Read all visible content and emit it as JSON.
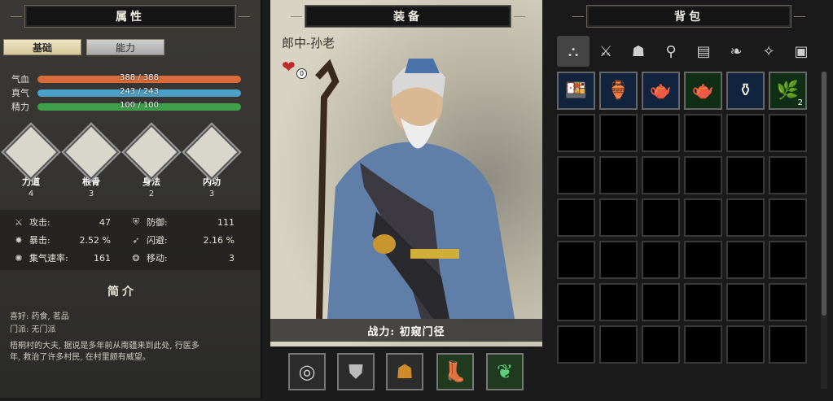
{
  "left": {
    "header": "属性",
    "tabs": [
      "基础",
      "能力"
    ],
    "bars": [
      {
        "label": "气血",
        "value": "388 / 388",
        "fill": 1.0,
        "color": "#d96a3a"
      },
      {
        "label": "真气",
        "value": "243 / 243",
        "fill": 1.0,
        "color": "#4aa0c8"
      },
      {
        "label": "精力",
        "value": "100 / 100",
        "fill": 1.0,
        "color": "#3fa04a"
      }
    ],
    "attributes": [
      {
        "name": "力道",
        "value": "4",
        "icon": "strength-figure-icon"
      },
      {
        "name": "根骨",
        "value": "3",
        "icon": "constitution-figure-icon"
      },
      {
        "name": "身法",
        "value": "2",
        "icon": "agility-figure-icon"
      },
      {
        "name": "内功",
        "value": "3",
        "icon": "inner-force-figure-icon"
      }
    ],
    "combat": [
      {
        "icon": "sword-icon",
        "label": "攻击:",
        "value": "47"
      },
      {
        "icon": "shield-icon",
        "label": "防御:",
        "value": "111"
      },
      {
        "icon": "burst-icon",
        "label": "暴击:",
        "value": "2.52 %"
      },
      {
        "icon": "dodge-icon",
        "label": "闪避:",
        "value": "2.16 %"
      },
      {
        "icon": "gather-icon",
        "label": "集气速率:",
        "value": "161"
      },
      {
        "icon": "footprint-icon",
        "label": "移动:",
        "value": "3"
      }
    ],
    "intro_title": "简介",
    "intro_lines": [
      "喜好: 药食, 茗品",
      "门派: 无门派",
      "梧桐村的大夫, 据说是多年前从南疆来到此处, 行医多",
      "年, 救治了许多村民, 在村里颇有威望。"
    ]
  },
  "middle": {
    "header": "装备",
    "character_name": "郎中-孙老",
    "heart_count": "0",
    "power_text": "战力: 初窥门径",
    "equipment": [
      "ring-icon",
      "armor-icon",
      "helmet-icon",
      "boots-icon",
      "jade-pendant-icon"
    ]
  },
  "right": {
    "header": "背包",
    "tabs": [
      "all-icon",
      "weapon-icon",
      "armor-icon",
      "accessory-icon",
      "book-icon",
      "herb-icon",
      "skill-icon",
      "misc-icon"
    ],
    "items": [
      {
        "icon": "tray-icon",
        "glyph": "🍱",
        "count": ""
      },
      {
        "icon": "bottle-icon",
        "glyph": "🏺",
        "count": ""
      },
      {
        "icon": "teapot-icon",
        "glyph": "🫖",
        "count": ""
      },
      {
        "icon": "dark-teapot-icon",
        "glyph": "🫖",
        "count": ""
      },
      {
        "icon": "gourd-bottle-icon",
        "glyph": "⚱",
        "count": ""
      },
      {
        "icon": "herb-plant-icon",
        "glyph": "🌿",
        "count": "2"
      }
    ]
  }
}
